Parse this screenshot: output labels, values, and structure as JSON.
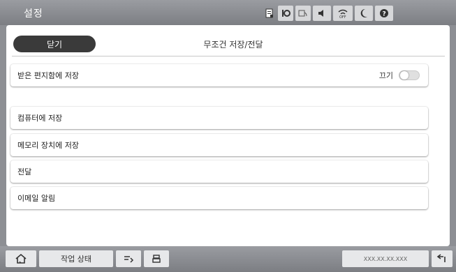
{
  "header": {
    "title": "설정",
    "icons": [
      "document-icon",
      "network-info-icon",
      "wifi-direct-icon",
      "volume-icon",
      "wifi-off-icon",
      "sleep-moon-icon",
      "help-icon"
    ]
  },
  "main": {
    "close_label": "닫기",
    "page_title": "무조건 저장/전달",
    "save_inbox_label": "받은 편지함에 저장",
    "toggle_label": "끄기",
    "toggle_on": false,
    "options": [
      "컴퓨터에 저장",
      "메모리 장치에 저장",
      "전달",
      "이메일 알림"
    ]
  },
  "footer": {
    "job_status_label": "작업 상태",
    "ip_address": "XXX.XX.XX.XXX"
  },
  "colors": {
    "bar_gray": "#8d8f94",
    "button_dark": "#3a3a3a"
  }
}
